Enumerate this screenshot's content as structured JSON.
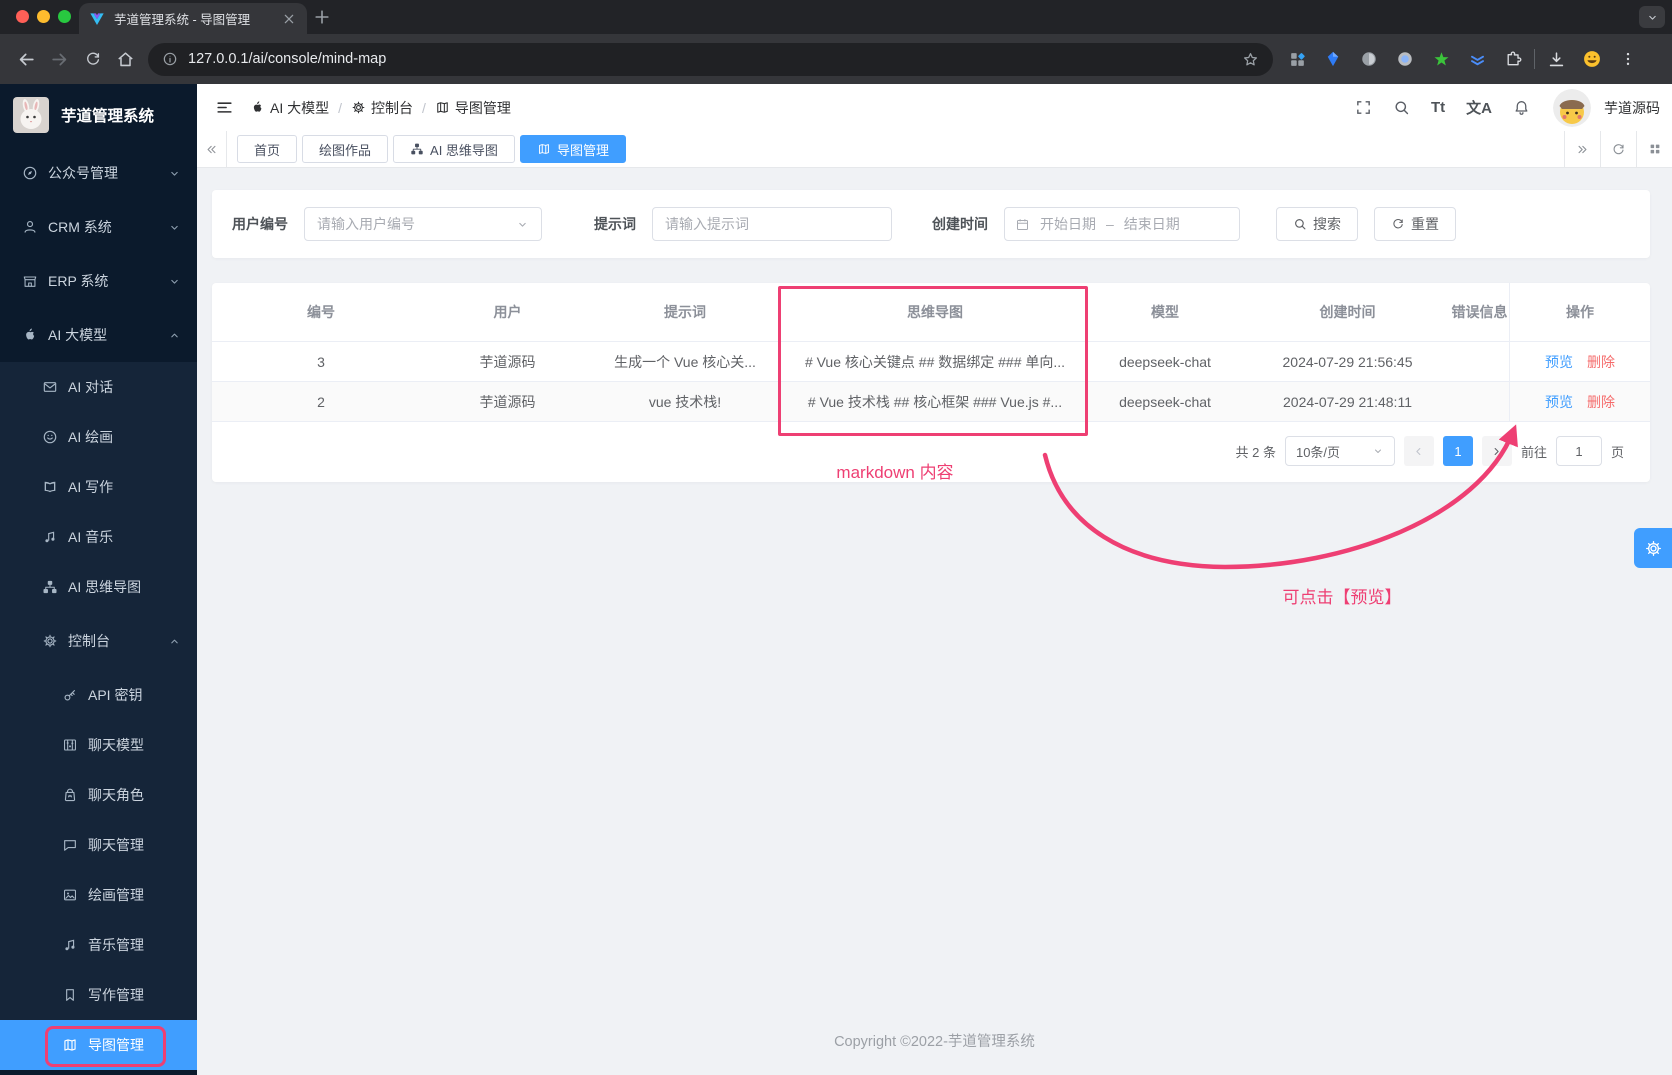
{
  "browser": {
    "tab_title": "芋道管理系统 - 导图管理",
    "url": "127.0.0.1/ai/console/mind-map"
  },
  "app": {
    "logo_title": "芋道管理系统"
  },
  "sidebar": {
    "items": [
      {
        "label": "公众号管理",
        "icon": "compass"
      },
      {
        "label": "CRM 系统",
        "icon": "user"
      },
      {
        "label": "ERP 系统",
        "icon": "shop"
      },
      {
        "label": "AI 大模型",
        "icon": "apple"
      },
      {
        "label": "AI 对话",
        "icon": "mail"
      },
      {
        "label": "AI 绘画",
        "icon": "draw"
      },
      {
        "label": "AI 写作",
        "icon": "write"
      },
      {
        "label": "AI 音乐",
        "icon": "music"
      },
      {
        "label": "AI 思维导图",
        "icon": "sitemap"
      },
      {
        "label": "控制台",
        "icon": "gear"
      },
      {
        "label": "API 密钥",
        "icon": "key"
      },
      {
        "label": "聊天模型",
        "icon": "model"
      },
      {
        "label": "聊天角色",
        "icon": "role"
      },
      {
        "label": "聊天管理",
        "icon": "chat"
      },
      {
        "label": "绘画管理",
        "icon": "image"
      },
      {
        "label": "音乐管理",
        "icon": "music"
      },
      {
        "label": "写作管理",
        "icon": "bookmark"
      },
      {
        "label": "导图管理",
        "icon": "map"
      }
    ]
  },
  "header": {
    "breadcrumb": [
      "AI 大模型",
      "控制台",
      "导图管理"
    ],
    "separator": "/",
    "font_tool": "Tt",
    "lang_tool": "文A",
    "user_name": "芋道源码"
  },
  "tabbar": {
    "tabs": [
      "首页",
      "绘图作品",
      "AI 思维导图",
      "导图管理"
    ]
  },
  "filters": {
    "user_label": "用户编号",
    "user_placeholder": "请输入用户编号",
    "prompt_label": "提示词",
    "prompt_placeholder": "请输入提示词",
    "date_label": "创建时间",
    "date_start": "开始日期",
    "date_sep": "–",
    "date_end": "结束日期",
    "search": "搜索",
    "reset": "重置"
  },
  "table": {
    "columns": [
      "编号",
      "用户",
      "提示词",
      "思维导图",
      "模型",
      "创建时间",
      "错误信息",
      "操作"
    ],
    "rows": [
      {
        "id": "3",
        "user": "芋道源码",
        "prompt": "生成一个 Vue 核心关...",
        "mindmap": "# Vue 核心关键点 ## 数据绑定 ### 单向...",
        "model": "deepseek-chat",
        "created": "2024-07-29 21:56:45",
        "error": ""
      },
      {
        "id": "2",
        "user": "芋道源码",
        "prompt": "vue 技术栈!",
        "mindmap": "# Vue 技术栈 ## 核心框架 ### Vue.js #...",
        "model": "deepseek-chat",
        "created": "2024-07-29 21:48:11",
        "error": ""
      }
    ],
    "action_preview": "预览",
    "action_delete": "删除"
  },
  "pagination": {
    "total": "共 2 条",
    "page_size": "10条/页",
    "page": "1",
    "goto_label": "前往",
    "goto_value": "1",
    "unit": "页"
  },
  "annotations": {
    "markdown_note": "markdown 内容",
    "preview_note": "可点击【预览】"
  },
  "footer": {
    "copyright": "Copyright ©2022-芋道管理系统"
  },
  "colors": {
    "accent": "#409eff",
    "annotation": "#ee3f73",
    "danger": "#f56c6c",
    "sidebar": "#0b1a2c"
  }
}
